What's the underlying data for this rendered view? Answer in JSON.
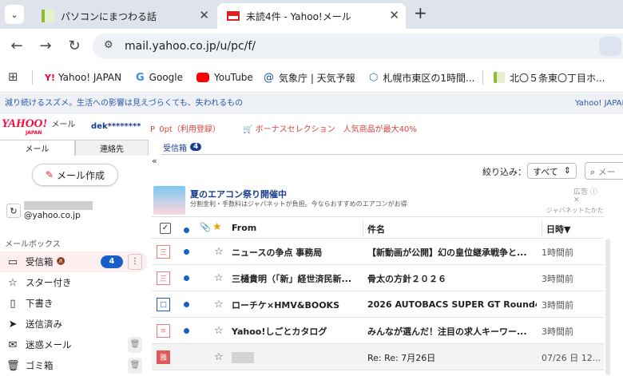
{
  "browser": {
    "tabs": [
      {
        "title": "パソコンにまつわる話"
      },
      {
        "title": "未読4件 - Yahoo!メール"
      }
    ],
    "new_tab": "+",
    "url": "mail.yahoo.co.jp/u/pc/f/",
    "bookmarks": [
      {
        "label": "Yahoo! JAPAN"
      },
      {
        "label": "Google"
      },
      {
        "label": "YouTube"
      },
      {
        "label": "気象庁 | 天気予報"
      },
      {
        "label": "札幌市東区の1時間..."
      },
      {
        "label": "北〇５条東〇丁目ホ..."
      }
    ]
  },
  "news": {
    "text": "減り続けるスズメ。生活への影響は見えづらくても、失われるもの",
    "right": "Yahoo! JAPAN"
  },
  "header": {
    "logo": "YAHOO!",
    "logo_sub": "JAPAN",
    "logo_mail": "メール",
    "user": "dek********",
    "points": "0pt（利用登録）",
    "bonus": "ボーナスセレクション　人気商品が最大40%"
  },
  "sidebar": {
    "tab_mail": "メール",
    "tab_contacts": "連絡先",
    "compose": "メール作成",
    "account": "@yahoo.co.jp",
    "mailbox_heading": "メールボックス",
    "folders": [
      {
        "label": "受信箱",
        "count": "4",
        "icon": "inbox-icon"
      },
      {
        "label": "スター付き",
        "icon": "star-icon"
      },
      {
        "label": "下書き",
        "icon": "draft-icon"
      },
      {
        "label": "送信済み",
        "icon": "send-icon"
      },
      {
        "label": "迷惑メール",
        "icon": "spam-icon"
      },
      {
        "label": "ゴミ箱",
        "icon": "trash-icon"
      }
    ]
  },
  "main": {
    "folder_tab": "受信箱",
    "folder_count": "4",
    "filter_label": "絞り込み：",
    "filter_value": "すべて",
    "search_placeholder": "メー",
    "ad": {
      "title": "夏のエアコン祭り開催中",
      "desc": "分割金利・手数料はジャパネットが負担。今ならおすすめのエアコンがお得",
      "badge": "広告",
      "sponsor": "ジャパネットたかた"
    },
    "columns": {
      "from": "From",
      "subject": "件名",
      "date": "日時▼"
    },
    "rows": [
      {
        "from": "ニュースの争点 事務局",
        "subject": "【新動画が公開】幻の皇位継承戦争と...",
        "date": "1時間前",
        "icon_color": "#e8787a",
        "icon_text": "三"
      },
      {
        "from": "三樋貴明（「新」経世済民新...",
        "subject": "骨太の方針２０２６",
        "date": "3時間前",
        "icon_color": "#e8787a",
        "icon_text": "三"
      },
      {
        "from": "ローチケ×HMV&BOOKS",
        "subject": "2026 AUTOBACS SUPER GT Round4...",
        "date": "3時間前",
        "icon_color": "#1c5fb8",
        "icon_text": "□"
      },
      {
        "from": "Yahoo!しごとカタログ",
        "subject": "みんなが選んだ！注目の求人キーワー...",
        "date": "3時間前",
        "icon_color": "#e8787a",
        "icon_text": "≡"
      },
      {
        "from": "",
        "subject": "Re: Re: 7月26日",
        "date": "07/26 日 12...",
        "icon_color": "#e05a5a",
        "icon_text": "雅"
      }
    ]
  }
}
